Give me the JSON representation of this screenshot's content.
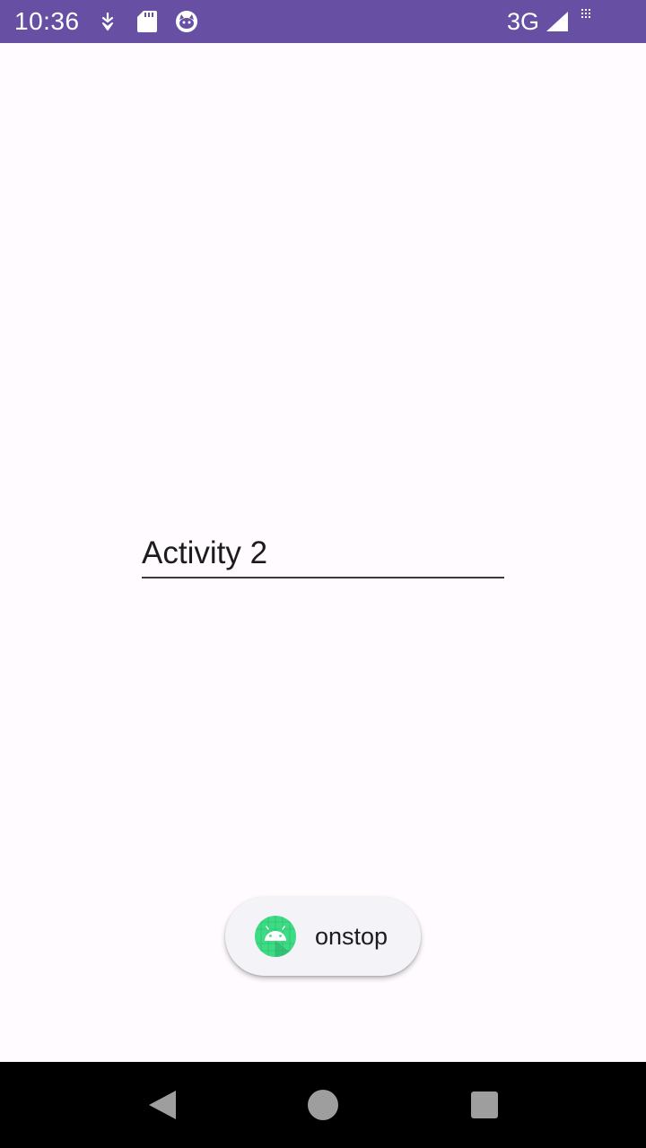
{
  "status_bar": {
    "time": "10:36",
    "network": "3G",
    "background_color": "#6750a4",
    "icons": [
      "download-icon",
      "sd-card-icon",
      "cat-face-icon",
      "signal-icon",
      "sim-icon"
    ]
  },
  "main": {
    "edit_text_value": "Activity 2"
  },
  "toast": {
    "message": "onstop",
    "icon": "android-icon"
  },
  "nav_bar": {
    "buttons": [
      "back-icon",
      "home-icon",
      "recents-icon"
    ]
  }
}
